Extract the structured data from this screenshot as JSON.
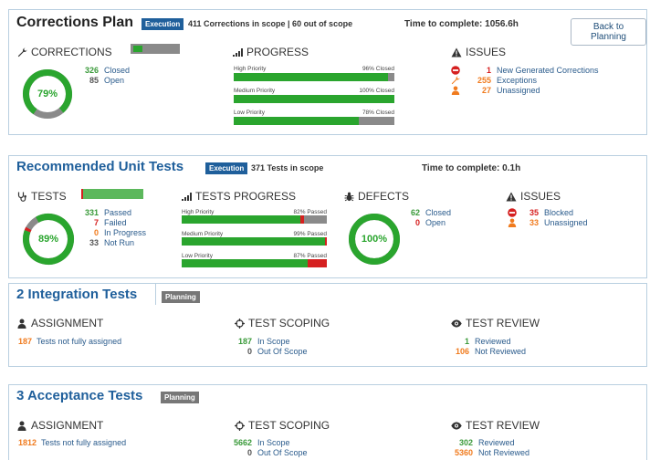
{
  "corrections_plan": {
    "title": "Corrections Plan",
    "badge": "Execution",
    "scope": "411 Corrections in scope | 60 out of scope",
    "time": "Time to complete: 1056.6h",
    "back_button": "Back to Planning",
    "corrections": {
      "heading": "CORRECTIONS",
      "percent": "79%",
      "percent_value": 79,
      "closed_num": "326",
      "closed_label": "Closed",
      "open_num": "85",
      "open_label": "Open"
    },
    "progress": {
      "heading": "PROGRESS",
      "bars": [
        {
          "label": "High Priority",
          "pct_text": "96% Closed",
          "value": 96
        },
        {
          "label": "Medium Priority",
          "pct_text": "100% Closed",
          "value": 100
        },
        {
          "label": "Low Priority",
          "pct_text": "78% Closed",
          "value": 78
        }
      ]
    },
    "issues": {
      "heading": "ISSUES",
      "items": [
        {
          "num": "1",
          "label": "New Generated Corrections",
          "icon": "no-entry-icon"
        },
        {
          "num": "255",
          "label": "Exceptions",
          "icon": "wrench-icon"
        },
        {
          "num": "27",
          "label": "Unassigned",
          "icon": "person-icon"
        }
      ]
    }
  },
  "unit_tests": {
    "title": "Recommended Unit Tests",
    "badge": "Execution",
    "scope": "371 Tests in scope",
    "time": "Time to complete: 0.1h",
    "tests": {
      "heading": "TESTS",
      "percent": "89%",
      "percent_value": 89,
      "items": [
        {
          "num": "331",
          "label": "Passed"
        },
        {
          "num": "7",
          "label": "Failed"
        },
        {
          "num": "0",
          "label": "In Progress"
        },
        {
          "num": "33",
          "label": "Not Run"
        }
      ]
    },
    "progress": {
      "heading": "TESTS PROGRESS",
      "bars": [
        {
          "label": "High Priority",
          "pct_text": "82% Passed",
          "value": 82,
          "failed": 2
        },
        {
          "label": "Medium Priority",
          "pct_text": "99% Passed",
          "value": 99,
          "failed": 1
        },
        {
          "label": "Low Priority",
          "pct_text": "87% Passed",
          "value": 87,
          "failed": 13
        }
      ]
    },
    "defects": {
      "heading": "DEFECTS",
      "percent": "100%",
      "percent_value": 100,
      "closed_num": "62",
      "closed_label": "Closed",
      "open_num": "0",
      "open_label": "Open"
    },
    "issues": {
      "heading": "ISSUES",
      "items": [
        {
          "num": "35",
          "label": "Blocked"
        },
        {
          "num": "33",
          "label": "Unassigned"
        }
      ]
    }
  },
  "integration_tests": {
    "title": "2 Integration Tests",
    "badge": "Planning",
    "assignment": {
      "heading": "ASSIGNMENT",
      "num": "187",
      "label": "Tests not fully assigned"
    },
    "scoping": {
      "heading": "TEST SCOPING",
      "in_num": "187",
      "in_label": "In Scope",
      "out_num": "0",
      "out_label": "Out Of Scope"
    },
    "review": {
      "heading": "TEST REVIEW",
      "rev_num": "1",
      "rev_label": "Reviewed",
      "notrev_num": "106",
      "notrev_label": "Not Reviewed"
    }
  },
  "acceptance_tests": {
    "title": "3 Acceptance Tests",
    "badge": "Planning",
    "assignment": {
      "heading": "ASSIGNMENT",
      "num": "1812",
      "label": "Tests not fully assigned"
    },
    "scoping": {
      "heading": "TEST SCOPING",
      "in_num": "5662",
      "in_label": "In Scope",
      "out_num": "0",
      "out_label": "Out Of Scope"
    },
    "review": {
      "heading": "TEST REVIEW",
      "rev_num": "302",
      "rev_label": "Reviewed",
      "notrev_num": "5360",
      "notrev_label": "Not Reviewed"
    }
  },
  "colors": {
    "green": "#2aa52e",
    "gray": "#8a8a8a",
    "red": "#d52020",
    "orange": "#f07b1e",
    "title_blue": "#1f5f9b"
  }
}
